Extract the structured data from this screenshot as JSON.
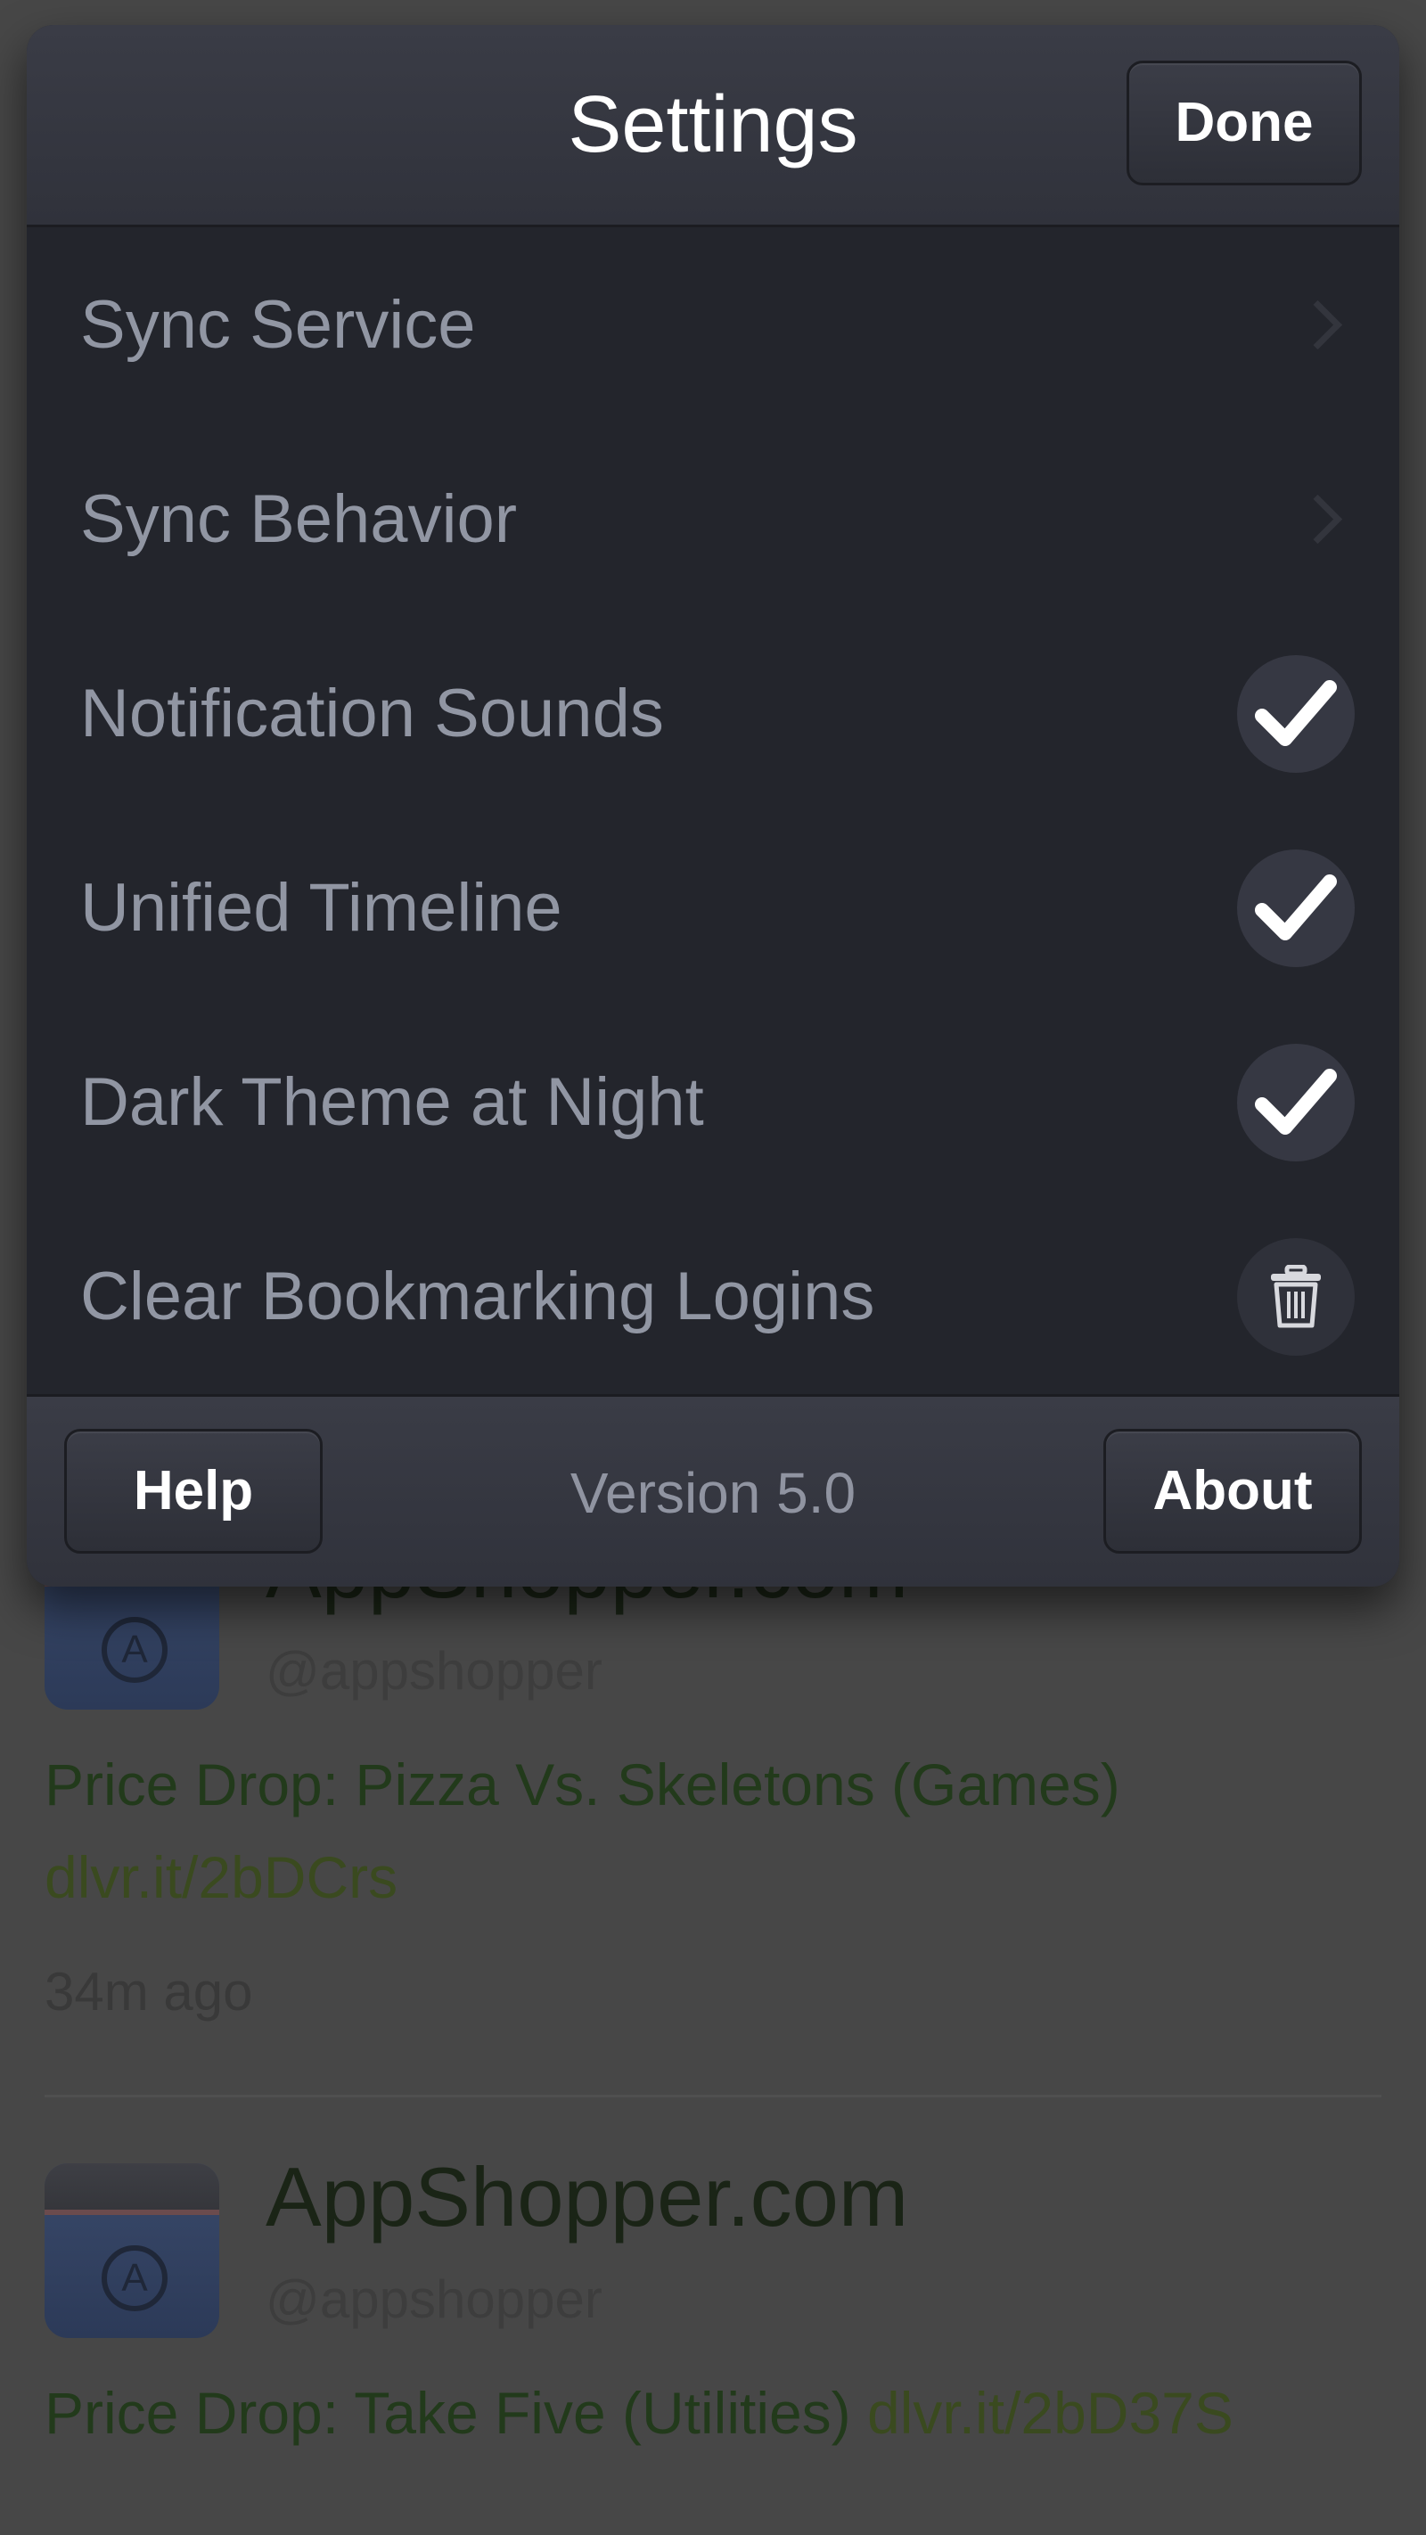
{
  "settings": {
    "title": "Settings",
    "done_label": "Done",
    "rows": [
      {
        "label": "Sync Service",
        "accessory": "chevron"
      },
      {
        "label": "Sync Behavior",
        "accessory": "chevron"
      },
      {
        "label": "Notification Sounds",
        "accessory": "checkmark",
        "checked": true
      },
      {
        "label": "Unified Timeline",
        "accessory": "checkmark",
        "checked": true
      },
      {
        "label": "Dark Theme at Night",
        "accessory": "checkmark",
        "checked": true
      },
      {
        "label": "Clear Bookmarking Logins",
        "accessory": "trash"
      }
    ],
    "footer": {
      "help_label": "Help",
      "version": "Version 5.0",
      "about_label": "About"
    }
  },
  "timeline": {
    "tweets": [
      {
        "author": "AppShopper.com",
        "handle": "@appshopper",
        "text": "Price Drop: Pizza Vs. Skeletons (Games)",
        "link": "dlvr.it/2bDCrs",
        "time": "34m ago",
        "avatar_letter": "A"
      },
      {
        "author": "AppShopper.com",
        "handle": "@appshopper",
        "text": "Price Drop: Take Five (Utilities)",
        "link": "dlvr.it/2bD37S",
        "avatar_letter": "A"
      }
    ]
  },
  "icons": {
    "chevron": "chevron-right-icon",
    "checkmark": "checkmark-icon",
    "trash": "trash-icon",
    "avatar": "app-avatar-icon"
  },
  "colors": {
    "sheet_background": "#23252c",
    "header_background": "#34363f",
    "row_text": "#9196a3",
    "badge_background": "#363843",
    "tweet_text": "#223a1b"
  }
}
